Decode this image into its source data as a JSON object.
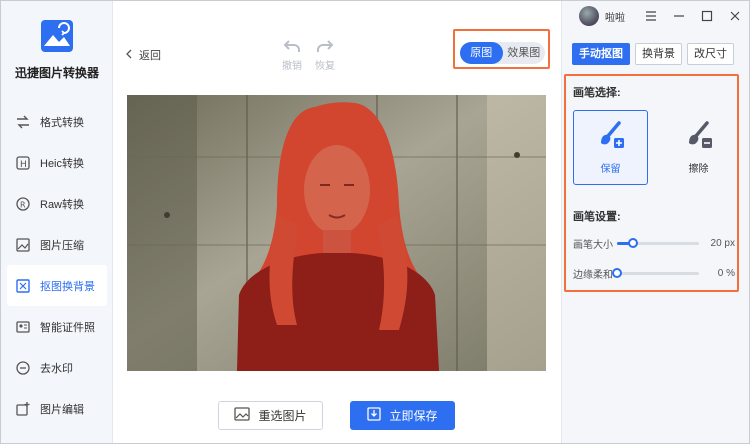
{
  "app": {
    "title": "迅捷图片转换器"
  },
  "sidebar": {
    "items": [
      {
        "label": "格式转换",
        "icon": "format-convert-icon"
      },
      {
        "label": "Heic转换",
        "icon": "heic-icon"
      },
      {
        "label": "Raw转换",
        "icon": "raw-icon"
      },
      {
        "label": "图片压缩",
        "icon": "compress-icon"
      },
      {
        "label": "抠图换背景",
        "icon": "cutout-icon",
        "active": true
      },
      {
        "label": "智能证件照",
        "icon": "id-photo-icon"
      },
      {
        "label": "去水印",
        "icon": "watermark-icon"
      },
      {
        "label": "图片编辑",
        "icon": "image-edit-icon"
      }
    ]
  },
  "toolbar": {
    "back_label": "返回",
    "undo_label": "撤销",
    "redo_label": "恢复",
    "view_original": "原图",
    "view_result": "效果图"
  },
  "actions": {
    "reselect_label": "重选图片",
    "save_label": "立即保存"
  },
  "titlebar": {
    "username": "啦啦"
  },
  "panel": {
    "tabs": [
      {
        "label": "手动抠图",
        "active": true
      },
      {
        "label": "换背景",
        "active": false
      },
      {
        "label": "改尺寸",
        "active": false
      }
    ],
    "brush_select_label": "画笔选择:",
    "keep_label": "保留",
    "erase_label": "擦除",
    "brush_settings_label": "画笔设置:",
    "brush_size": {
      "label": "画笔大小",
      "value": "20 px",
      "fraction": 0.2
    },
    "edge_soft": {
      "label": "边缘柔和",
      "value": "0 %",
      "fraction": 0.0
    }
  },
  "colors": {
    "accent": "#2d6ff0",
    "highlight": "#f36f3c",
    "mask": "#c8281e"
  }
}
